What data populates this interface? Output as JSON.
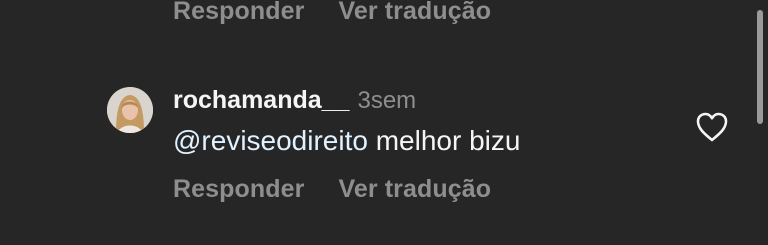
{
  "previous_comment": {
    "reply_label": "Responder",
    "translate_label": "Ver tradução"
  },
  "comment": {
    "username": "rochamanda__",
    "time_ago": "3sem",
    "mention": "@reviseodireito",
    "text": " melhor bizu",
    "reply_label": "Responder",
    "translate_label": "Ver tradução",
    "like_icon": "heart-outline-icon"
  },
  "colors": {
    "background": "#262626",
    "primary_text": "#f5f5f5",
    "secondary_text": "#8e8e8e",
    "mention": "#e0f1ff"
  }
}
